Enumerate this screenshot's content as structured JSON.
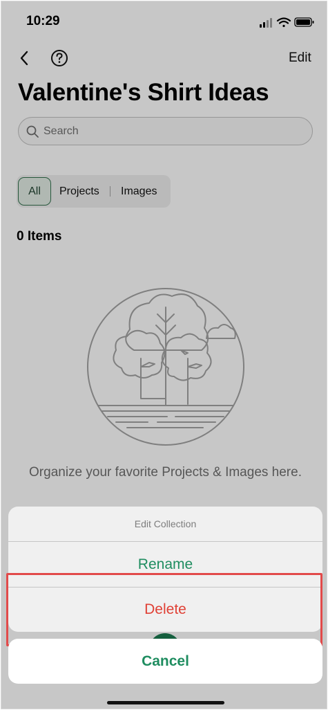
{
  "status_bar": {
    "time": "10:29"
  },
  "nav": {
    "edit_label": "Edit"
  },
  "page": {
    "title": "Valentine's Shirt Ideas"
  },
  "search": {
    "placeholder": "Search"
  },
  "tabs": [
    {
      "label": "All",
      "selected": true
    },
    {
      "label": "Projects",
      "selected": false
    },
    {
      "label": "Images",
      "selected": false
    }
  ],
  "item_count": "0 Items",
  "empty_state": {
    "message": "Organize your favorite Projects & Images here."
  },
  "action_sheet": {
    "title": "Edit Collection",
    "rename_label": "Rename",
    "delete_label": "Delete",
    "cancel_label": "Cancel"
  },
  "colors": {
    "accent_green": "#1f8d60",
    "destructive_red": "#e04035",
    "highlight_red": "#e24a4a"
  },
  "icons": [
    "back-chevron-icon",
    "help-icon",
    "search-icon",
    "signal-icon",
    "wifi-icon",
    "battery-icon",
    "tree-illustration"
  ]
}
